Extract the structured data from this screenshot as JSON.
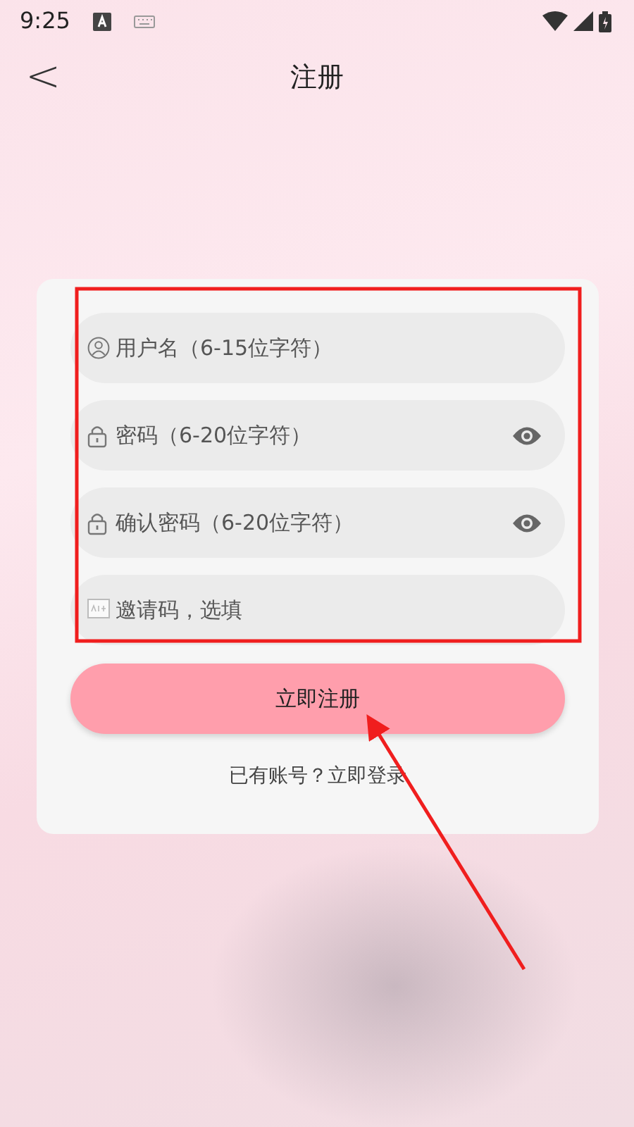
{
  "status_bar": {
    "time": "9:25"
  },
  "header": {
    "back": "<",
    "title": "注册"
  },
  "form": {
    "fields": [
      {
        "kind": "username",
        "placeholder": "用户名（6-15位字符）"
      },
      {
        "kind": "password",
        "placeholder": "密码（6-20位字符）"
      },
      {
        "kind": "password",
        "placeholder": "确认密码（6-20位字符）"
      },
      {
        "kind": "invite",
        "placeholder": "邀请码，选填"
      }
    ],
    "submit": "立即注册",
    "login_link": "已有账号？立即登录"
  }
}
